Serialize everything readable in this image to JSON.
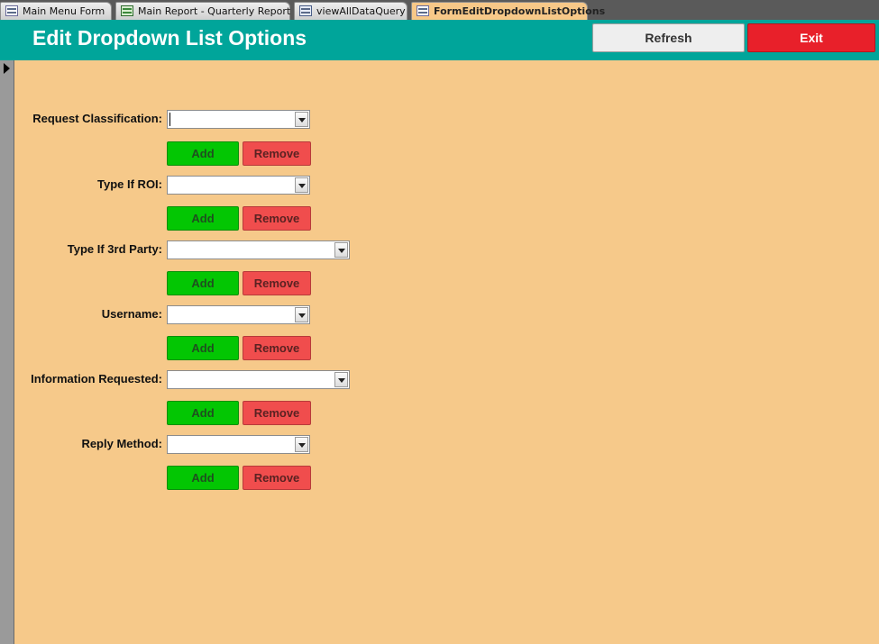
{
  "tabs": [
    {
      "label": "Main Menu Form",
      "icon": "form-icon"
    },
    {
      "label": "Main Report - Quarterly Report",
      "icon": "report-icon"
    },
    {
      "label": "viewAllDataQuery",
      "icon": "query-icon"
    },
    {
      "label": "FormEditDropdownListOptions",
      "icon": "form-icon",
      "active": true
    }
  ],
  "header": {
    "title": "Edit Dropdown List Options",
    "refresh_label": "Refresh",
    "exit_label": "Exit"
  },
  "fields": [
    {
      "label": "Request Classification:",
      "value": "",
      "add_label": "Add",
      "remove_label": "Remove"
    },
    {
      "label": "Type If ROI:",
      "value": "",
      "add_label": "Add",
      "remove_label": "Remove"
    },
    {
      "label": "Type If 3rd Party:",
      "value": "",
      "add_label": "Add",
      "remove_label": "Remove"
    },
    {
      "label": "Username:",
      "value": "",
      "add_label": "Add",
      "remove_label": "Remove"
    },
    {
      "label": "Information Requested:",
      "value": "",
      "add_label": "Add",
      "remove_label": "Remove"
    },
    {
      "label": "Reply Method:",
      "value": "",
      "add_label": "Add",
      "remove_label": "Remove"
    }
  ],
  "colors": {
    "header_bg": "#00a59a",
    "form_bg": "#f6c98a",
    "add_button": "#03c603",
    "remove_button": "#f04d4d",
    "exit_button": "#e8202a"
  }
}
